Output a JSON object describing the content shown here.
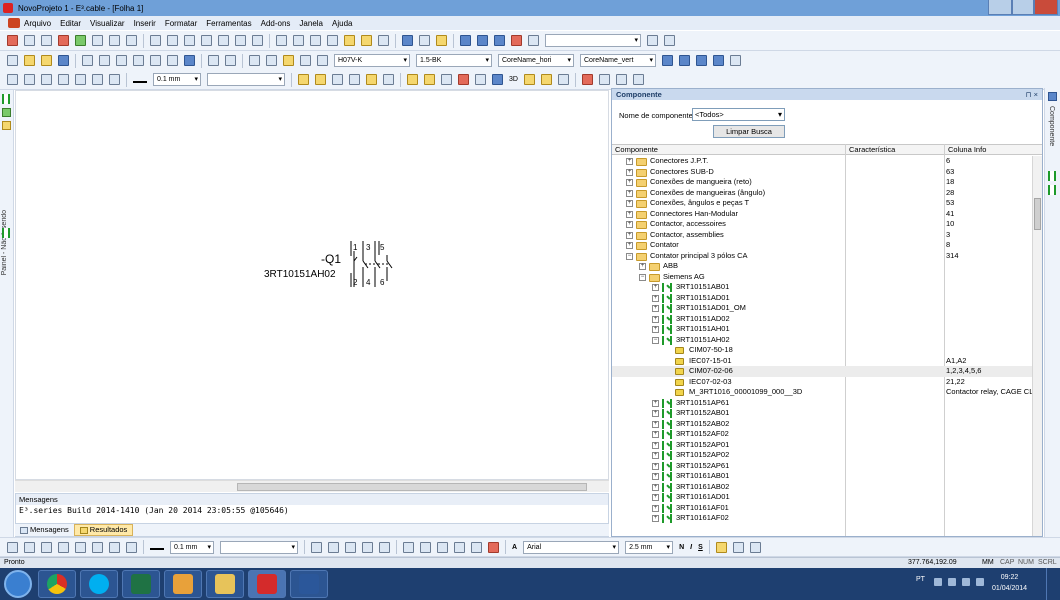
{
  "window": {
    "title": "NovoProjeto 1 - E³.cable - [Folha 1]"
  },
  "menu": [
    "Arquivo",
    "Editar",
    "Visualizar",
    "Inserir",
    "Formatar",
    "Ferramentas",
    "Add-ons",
    "Janela",
    "Ajuda"
  ],
  "toolbar2": {
    "cable_type": "H07V-K",
    "wire": "1.5-BK",
    "core_h": "CoreName_hori",
    "core_v": "CoreName_vert"
  },
  "toolbar3": {
    "line_width": "0.1 mm",
    "btn_3d": "3D"
  },
  "left_panel": {
    "label": "Painel - Não Inserido"
  },
  "right_panel": {
    "label": "Componente"
  },
  "schematic": {
    "ref": "-Q1",
    "part": "3RT10151AH02",
    "pins_top": [
      "1",
      "3",
      "5"
    ],
    "pins_bottom": [
      "2",
      "4",
      "6"
    ]
  },
  "messages": {
    "header": "Mensagens",
    "line1": "E³.series Build 2014-1410 (Jan 20 2014 23:05:55 @105646)",
    "tabs": [
      "Mensagens",
      "Resultados"
    ]
  },
  "drawbar": {
    "line_width": "0.1 mm",
    "font": "Arial",
    "font_size": "2.5 mm",
    "bold": "N",
    "italic": "I",
    "strike": "S"
  },
  "component_panel": {
    "title": "Componente",
    "filter_label": "Nome de componente",
    "filter_value": "<Todos>",
    "clear_button": "Limpar Busca",
    "columns": [
      "Componente",
      "Característica",
      "Coluna Info"
    ],
    "rows": [
      {
        "name": "Conectores J.P.T.",
        "info": "6",
        "lvl": 0,
        "kind": "folder",
        "exp": "+"
      },
      {
        "name": "Conectores SUB-D",
        "info": "63",
        "lvl": 0,
        "kind": "folder",
        "exp": "+"
      },
      {
        "name": "Conexões de mangueira (reto)",
        "info": "18",
        "lvl": 0,
        "kind": "folder",
        "exp": "+"
      },
      {
        "name": "Conexões de mangueiras (ângulo)",
        "info": "28",
        "lvl": 0,
        "kind": "folder",
        "exp": "+"
      },
      {
        "name": "Conexões, ângulos e peças T",
        "info": "53",
        "lvl": 0,
        "kind": "folder",
        "exp": "+"
      },
      {
        "name": "Connectores Han-Modular",
        "info": "41",
        "lvl": 0,
        "kind": "folder",
        "exp": "+"
      },
      {
        "name": "Contactor, accessoires",
        "info": "10",
        "lvl": 0,
        "kind": "folder",
        "exp": "+"
      },
      {
        "name": "Contactor, assemblies",
        "info": "3",
        "lvl": 0,
        "kind": "folder",
        "exp": "+"
      },
      {
        "name": "Contator",
        "info": "8",
        "lvl": 0,
        "kind": "folder",
        "exp": "+"
      },
      {
        "name": "Contator principal 3 pólos CA",
        "info": "314",
        "lvl": 0,
        "kind": "folder",
        "exp": "−"
      },
      {
        "name": "ABB",
        "info": "",
        "lvl": 1,
        "kind": "folder",
        "exp": "+"
      },
      {
        "name": "Siemens AG",
        "info": "",
        "lvl": 1,
        "kind": "folder",
        "exp": "−"
      },
      {
        "name": "3RT10151AB01",
        "info": "",
        "lvl": 2,
        "kind": "part",
        "exp": "+"
      },
      {
        "name": "3RT10151AD01",
        "info": "",
        "lvl": 2,
        "kind": "part",
        "exp": "+"
      },
      {
        "name": "3RT10151AD01_OM",
        "info": "",
        "lvl": 2,
        "kind": "part",
        "exp": "+"
      },
      {
        "name": "3RT10151AD02",
        "info": "",
        "lvl": 2,
        "kind": "part",
        "exp": "+"
      },
      {
        "name": "3RT10151AH01",
        "info": "",
        "lvl": 2,
        "kind": "part",
        "exp": "+"
      },
      {
        "name": "3RT10151AH02",
        "info": "",
        "lvl": 2,
        "kind": "part",
        "exp": "−"
      },
      {
        "name": "CIM07-50-18",
        "info": "",
        "lvl": 3,
        "kind": "pin",
        "exp": ""
      },
      {
        "name": "IEC07-15-01",
        "info": "A1,A2",
        "lvl": 3,
        "kind": "pin",
        "exp": ""
      },
      {
        "name": "CIM07-02-06",
        "info": "1,2,3,4,5,6",
        "lvl": 3,
        "kind": "pin",
        "exp": "",
        "sel": true
      },
      {
        "name": "IEC07-02-03",
        "info": "21,22",
        "lvl": 3,
        "kind": "pin",
        "exp": ""
      },
      {
        "name": "M_3RT1016_00001099_000__3D",
        "info": "Contactor relay, CAGE CLA",
        "lvl": 3,
        "kind": "pin",
        "exp": ""
      },
      {
        "name": "3RT10151AP61",
        "info": "",
        "lvl": 2,
        "kind": "part",
        "exp": "+"
      },
      {
        "name": "3RT10152AB01",
        "info": "",
        "lvl": 2,
        "kind": "part",
        "exp": "+"
      },
      {
        "name": "3RT10152AB02",
        "info": "",
        "lvl": 2,
        "kind": "part",
        "exp": "+"
      },
      {
        "name": "3RT10152AF02",
        "info": "",
        "lvl": 2,
        "kind": "part",
        "exp": "+"
      },
      {
        "name": "3RT10152AP01",
        "info": "",
        "lvl": 2,
        "kind": "part",
        "exp": "+"
      },
      {
        "name": "3RT10152AP02",
        "info": "",
        "lvl": 2,
        "kind": "part",
        "exp": "+"
      },
      {
        "name": "3RT10152AP61",
        "info": "",
        "lvl": 2,
        "kind": "part",
        "exp": "+"
      },
      {
        "name": "3RT10161AB01",
        "info": "",
        "lvl": 2,
        "kind": "part",
        "exp": "+"
      },
      {
        "name": "3RT10161AB02",
        "info": "",
        "lvl": 2,
        "kind": "part",
        "exp": "+"
      },
      {
        "name": "3RT10161AD01",
        "info": "",
        "lvl": 2,
        "kind": "part",
        "exp": "+"
      },
      {
        "name": "3RT10161AF01",
        "info": "",
        "lvl": 2,
        "kind": "part",
        "exp": "+"
      },
      {
        "name": "3RT10161AF02",
        "info": "",
        "lvl": 2,
        "kind": "part",
        "exp": "+"
      }
    ]
  },
  "status": {
    "left": "Pronto",
    "coords": "377.764,192.09",
    "mm": "MM",
    "cap": "CAP",
    "num": "NUM",
    "scrl": "SCRL"
  },
  "taskbar": {
    "lang": "PT",
    "time": "09:22",
    "date": "01/04/2014"
  }
}
